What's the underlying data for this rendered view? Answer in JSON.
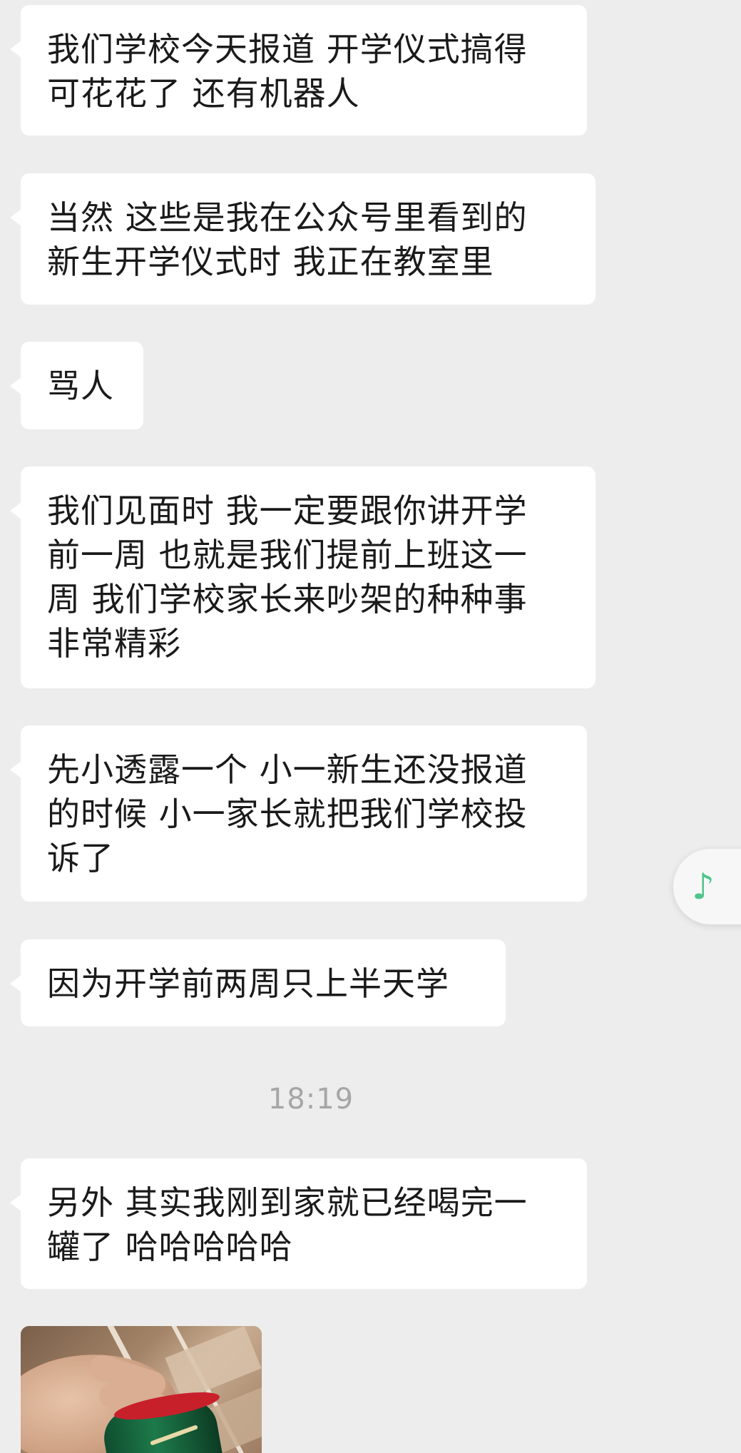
{
  "messages": [
    {
      "text": "我们学校今天报道 开学仪式搞得\n可花花了 还有机器人"
    },
    {
      "text": "当然 这些是我在公众号里看到的\n新生开学仪式时 我正在教室里"
    },
    {
      "text": "骂人"
    },
    {
      "text": "我们见面时 我一定要跟你讲开学\n前一周 也就是我们提前上班这一\n周 我们学校家长来吵架的种种事\n非常精彩"
    },
    {
      "text": "先小透露一个 小一新生还没报道\n的时候 小一家长就把我们学校投\n诉了"
    },
    {
      "text": "因为开学前两周只上半天学"
    },
    {
      "text": "另外 其实我刚到家就已经喝完一\n罐了 哈哈哈哈哈"
    }
  ],
  "timestamp": "18:19",
  "floating_button": {
    "icon": "music-note-icon",
    "glyph": "♪",
    "color": "#4fc58b"
  },
  "photo": {
    "alt_subject": "hand holding a green beverage can"
  },
  "colors": {
    "background": "#ededed",
    "bubble": "#ffffff",
    "timestamp_text": "#a6a6a6",
    "accent_green": "#4fc58b"
  }
}
